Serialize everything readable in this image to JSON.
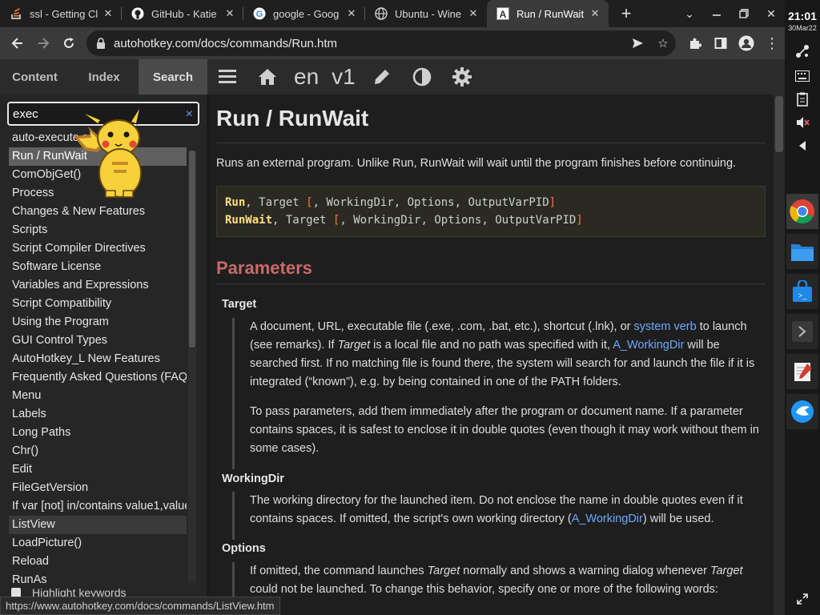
{
  "tabs": [
    {
      "title": "ssl - Getting Cl",
      "icon": "stackoverflow-icon"
    },
    {
      "title": "GitHub - Katie",
      "icon": "github-icon"
    },
    {
      "title": "google - Goog",
      "icon": "google-icon"
    },
    {
      "title": "Ubuntu - Wine",
      "icon": "globe-icon"
    },
    {
      "title": "Run / RunWait",
      "icon": "autohotkey-icon"
    }
  ],
  "address": {
    "url": "autohotkey.com/docs/commands/Run.htm"
  },
  "doc_toolbar": {
    "tabs": [
      "Content",
      "Index",
      "Search"
    ],
    "lang": "en",
    "version": "v1"
  },
  "search": {
    "value": "exec",
    "clear": "×"
  },
  "results": [
    "auto-execute section",
    "Run / RunWait",
    "ComObjGet()",
    "Process",
    "Changes & New Features",
    "Scripts",
    "Script Compiler Directives",
    "Software License",
    "Variables and Expressions",
    "Script Compatibility",
    "Using the Program",
    "GUI Control Types",
    "AutoHotkey_L New Features",
    "Frequently Asked Questions (FAQ",
    "Menu",
    "Labels",
    "Long Paths",
    "Chr()",
    "Edit",
    "FileGetVersion",
    "If var [not] in/contains value1,value",
    "ListView",
    "LoadPicture()",
    "Reload",
    "RunAs"
  ],
  "highlight_label": "Highlight keywords",
  "content": {
    "title": "Run / RunWait",
    "intro": "Runs an external program. Unlike Run, RunWait will wait until the program finishes before continuing.",
    "syntax": {
      "line1_cmd": "Run",
      "line1_args": "Target ",
      "line1_opt": "WorkingDir, Options, OutputVarPID",
      "line2_cmd": "RunWait",
      "line2_args": "Target ",
      "line2_opt": "WorkingDir, Options, OutputVarPID"
    },
    "parameters_heading": "Parameters",
    "target": {
      "name": "Target",
      "p1a": "A document, URL, executable file (.exe, .com, .bat, etc.), shortcut (.lnk), or ",
      "p1_link1": "system verb",
      "p1b": " to launch (see remarks). If ",
      "p1_italic": "Target",
      "p1c": " is a local file and no path was specified with it, ",
      "p1_link2": "A_WorkingDir",
      "p1d": " will be searched first. If no matching file is found there, the system will search for and launch the file if it is integrated (“known”), e.g. by being contained in one of the PATH folders.",
      "p2": "To pass parameters, add them immediately after the program or document name. If a parameter contains spaces, it is safest to enclose it in double quotes (even though it may work without them in some cases)."
    },
    "workingdir": {
      "name": "WorkingDir",
      "pa": "The working directory for the launched item. Do not enclose the name in double quotes even if it contains spaces. If omitted, the script's own working directory (",
      "link": "A_WorkingDir",
      "pb": ") will be used."
    },
    "options": {
      "name": "Options",
      "pa": "If omitted, the command launches ",
      "italic1": "Target",
      "pb": " normally and shows a warning dialog whenever ",
      "italic2": "Target",
      "pc": " could not be launched. To change this behavior, specify one or more of the following words:"
    }
  },
  "status_url": "https://www.autohotkey.com/docs/commands/ListView.htm",
  "system": {
    "time": "21:01",
    "date": "30Mar22"
  },
  "colors": {
    "accent_link": "#6ea8ff",
    "heading": "#c86a6a",
    "keyword": "#ffe082",
    "bracket": "#ff7043"
  }
}
